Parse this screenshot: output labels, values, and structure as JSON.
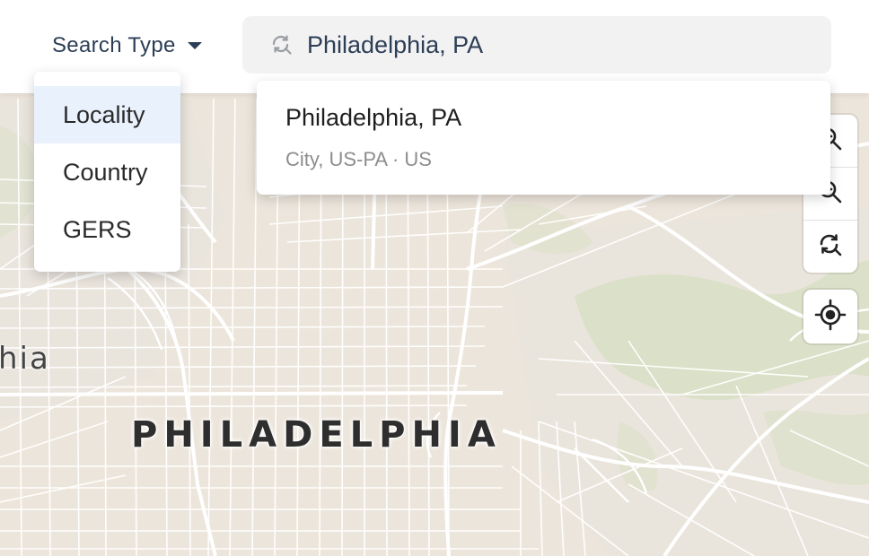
{
  "header": {
    "search_type_label": "Search Type",
    "search_value": "Philadelphia, PA"
  },
  "type_menu": {
    "items": [
      {
        "label": "Locality",
        "active": true
      },
      {
        "label": "Country",
        "active": false
      },
      {
        "label": "GERS",
        "active": false
      }
    ]
  },
  "result": {
    "title": "Philadelphia, PA",
    "subtitle": "City, US-PA · US"
  },
  "map": {
    "city_label": "PHILADELPHIA",
    "partial_label": "hia"
  },
  "icons": {
    "search": "search-refresh-icon",
    "caret": "caret-down-icon",
    "zoom_in": "zoom-in-icon",
    "zoom_out": "zoom-out-icon",
    "reset": "search-refresh-icon",
    "locate": "crosshair-icon"
  },
  "colors": {
    "map_background": "#ede7de",
    "roads": "#ffffff",
    "park_green": "#d9e0c4",
    "header_text": "#2c3e55",
    "active_menu_bg": "#e9f1fc",
    "subtitle_text": "#8d8d8d"
  }
}
